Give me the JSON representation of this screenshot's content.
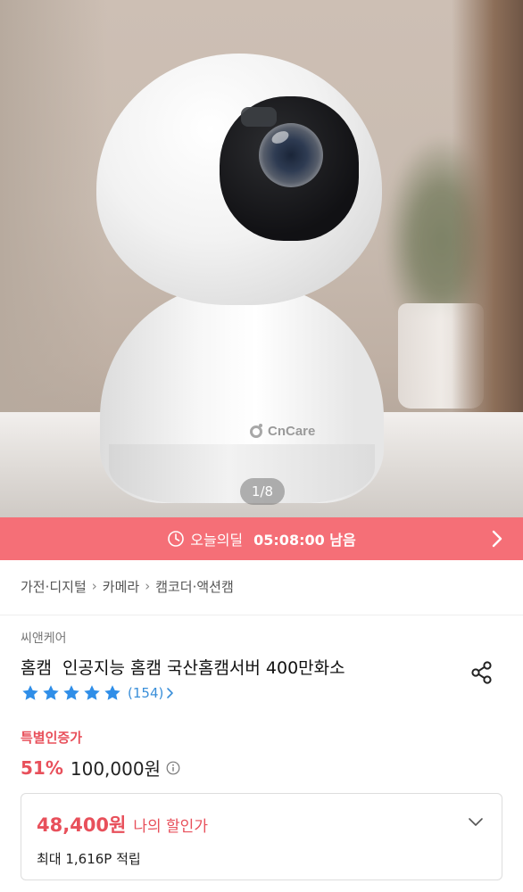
{
  "product_image": {
    "brand_logo_text": "CnCare",
    "page_indicator": "1/8"
  },
  "deal": {
    "label": "오늘의딜",
    "time_left": "05:08:00 남음",
    "accent_color": "#f56f77"
  },
  "breadcrumb": [
    "가전·디지털",
    "카메라",
    "캠코더·액션캠"
  ],
  "product": {
    "seller": "씨앤케어",
    "title": "홈캠  인공지능 홈캠 국산홈캠서버 400만화소",
    "stars": 5,
    "review_count": "(154)",
    "special_label": "특별인증가",
    "discount_rate": "51%",
    "original_price": "100,000원"
  },
  "member_card": {
    "price": "48,400원",
    "label": "나의 할인가",
    "points": "최대 1,616P 적립"
  },
  "colors": {
    "sale_red": "#e8505b",
    "review_blue": "#3a8fd9",
    "star_blue": "#2f8ee8"
  },
  "icons": [
    "clock-icon",
    "chevron-right-icon",
    "share-icon",
    "star-icon",
    "info-icon",
    "chevron-down-icon"
  ]
}
